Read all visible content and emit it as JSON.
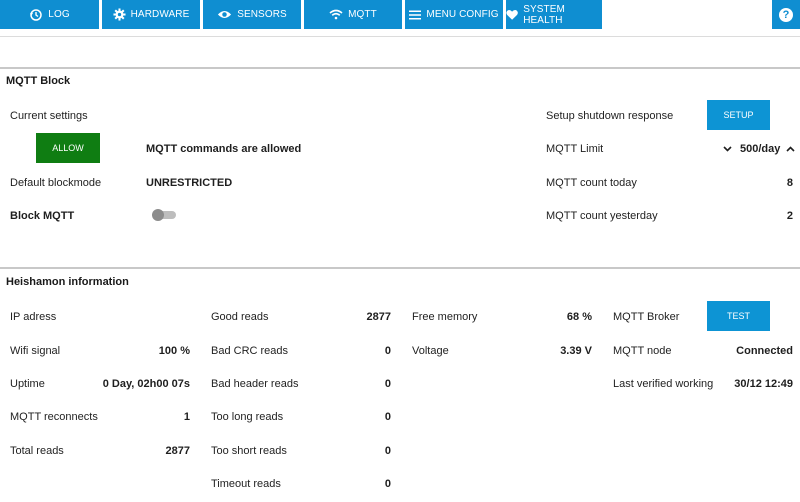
{
  "nav": {
    "items": [
      {
        "label": "LOG",
        "icon": "history-icon"
      },
      {
        "label": "HARDWARE",
        "icon": "gear-icon"
      },
      {
        "label": "SENSORS",
        "icon": "eye-icon"
      },
      {
        "label": "MQTT",
        "icon": "wifi-icon"
      },
      {
        "label": "MENU CONFIG",
        "icon": "menu-icon"
      },
      {
        "label": "SYSTEM HEALTH",
        "icon": "heart-icon"
      }
    ],
    "help": "?",
    "color": "#0f8ed1"
  },
  "mqtt_block": {
    "title": "MQTT Block",
    "current_settings_label": "Current settings",
    "allow_button": "ALLOW",
    "status_text": "MQTT commands are allowed",
    "default_blockmode_label": "Default blockmode",
    "default_blockmode_value": "UNRESTRICTED",
    "block_mqtt_label": "Block MQTT",
    "block_mqtt_on": false,
    "setup_label": "Setup shutdown response",
    "setup_button": "SETUP",
    "limit_label": "MQTT Limit",
    "limit_value": "500/day",
    "count_today_label": "MQTT count today",
    "count_today_value": "8",
    "count_yesterday_label": "MQTT count yesterday",
    "count_yesterday_value": "2"
  },
  "heishamon": {
    "title": "Heishamon information",
    "col1": [
      {
        "label": "IP adress",
        "value": ""
      },
      {
        "label": "Wifi signal",
        "value": "100 %"
      },
      {
        "label": "Uptime",
        "value": "0 Day, 02h00 07s"
      },
      {
        "label": "MQTT reconnects",
        "value": "1"
      },
      {
        "label": "Total reads",
        "value": "2877"
      }
    ],
    "col2": [
      {
        "label": "Good reads",
        "value": "2877"
      },
      {
        "label": "Bad CRC reads",
        "value": "0"
      },
      {
        "label": "Bad header reads",
        "value": "0"
      },
      {
        "label": "Too long reads",
        "value": "0"
      },
      {
        "label": "Too short reads",
        "value": "0"
      },
      {
        "label": "Timeout reads",
        "value": "0"
      }
    ],
    "col3": [
      {
        "label": "Free memory",
        "value": "68 %"
      },
      {
        "label": "Voltage",
        "value": "3.39 V"
      }
    ],
    "col4": {
      "broker_label": "MQTT Broker",
      "test_button": "TEST",
      "node_label": "MQTT node",
      "node_value": "Connected",
      "verified_label": "Last verified working",
      "verified_value": "30/12 12:49"
    }
  },
  "colors": {
    "accent": "#0f8ed1",
    "allow_green": "#0f7d12"
  }
}
